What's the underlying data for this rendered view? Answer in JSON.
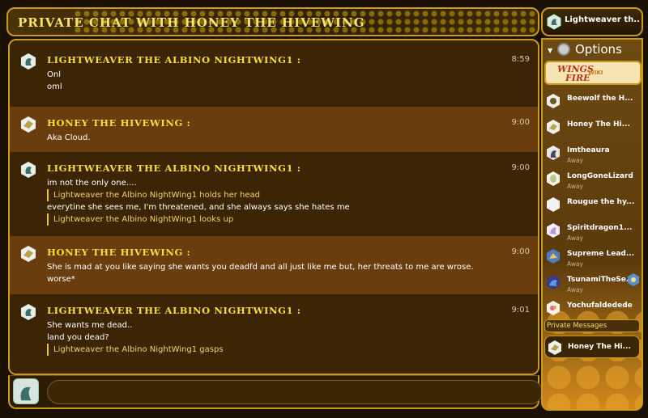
{
  "header": {
    "title": "PRIVATE CHAT WITH HONEY THE HIVEWING",
    "current_user": "Lightweaver th..."
  },
  "messages": [
    {
      "author": "LIGHTWEAVER THE ALBINO NIGHTWING1 :",
      "time": "8:59",
      "lines": [
        "Onl",
        "oml"
      ]
    },
    {
      "author": "HONEY THE HIVEWING :",
      "time": "9:00",
      "lines": [
        "Aka Cloud."
      ]
    },
    {
      "author": "LIGHTWEAVER THE ALBINO NIGHTWING1 :",
      "time": "9:00",
      "lines": [
        "im not the only one....",
        "Lightweaver the Albino NightWing1 holds her head",
        "everytine she sees me, I'm threatened, and she always says she hates me",
        "Lightweaver the Albino NightWing1 looks up"
      ]
    },
    {
      "author": "HONEY THE HIVEWING :",
      "time": "9:00",
      "lines": [
        "She is mad at you like saying she wants you deadfd and all just like me but, her threats to me are wrose.",
        "worse*"
      ]
    },
    {
      "author": "LIGHTWEAVER THE ALBINO NIGHTWING1 :",
      "time": "9:01",
      "lines": [
        "She wants me dead..",
        "land you dead?",
        "Lightweaver the Albino NightWing1 gasps"
      ]
    }
  ],
  "sidebar": {
    "options_label": "Options",
    "wiki_logo": {
      "line1": "WINGS",
      "line2": "FIRE",
      "badge": "WIKI"
    },
    "users": [
      {
        "name": "Beewolf the H...",
        "status": ""
      },
      {
        "name": "Honey The Hi...",
        "status": ""
      },
      {
        "name": "Imtheaura",
        "status": "Away"
      },
      {
        "name": "LongGoneLizard",
        "status": "Away"
      },
      {
        "name": "Rougue the hy...",
        "status": ""
      },
      {
        "name": "Spiritdragon1...",
        "status": "Away"
      },
      {
        "name": "Supreme Lead...",
        "status": "Away"
      },
      {
        "name": "TsunamiTheSe...",
        "status": "Away"
      },
      {
        "name": "Yochufaldedede",
        "status": ""
      }
    ],
    "private_messages_label": "Private Messages",
    "private_user": "Honey The Hi..."
  },
  "input": {
    "placeholder": "",
    "value": ""
  },
  "colors": {
    "accent": "#c99a1c",
    "name": "#f7de3a",
    "action": "#f0d56a"
  }
}
